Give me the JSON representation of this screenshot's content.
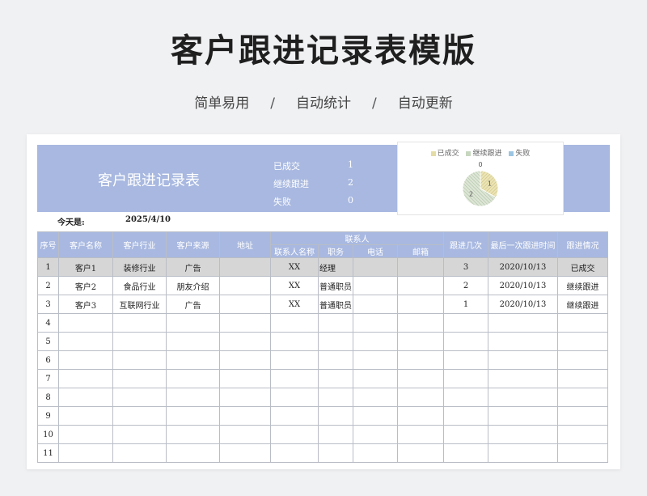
{
  "page": {
    "title": "客户跟进记录表模版",
    "features": [
      "简单易用",
      "自动统计",
      "自动更新"
    ],
    "separator": "/"
  },
  "banner": {
    "title": "客户跟进记录表",
    "stats": [
      {
        "label": "已成交",
        "value": "1"
      },
      {
        "label": "继续跟进",
        "value": "2"
      },
      {
        "label": "失败",
        "value": "0"
      }
    ]
  },
  "chart_data": {
    "type": "pie",
    "categories": [
      "已成交",
      "继续跟进",
      "失败"
    ],
    "values": [
      1,
      2,
      0
    ],
    "data_labels": [
      "1",
      "2",
      "0"
    ],
    "colors": [
      "#e4dca6",
      "#c7d6bf",
      "#9cc5e2"
    ],
    "legend": "top"
  },
  "today": {
    "label": "今天是:",
    "value": "2025/4/10"
  },
  "table": {
    "headers": {
      "seq": "序号",
      "name": "客户名称",
      "industry": "客户行业",
      "source": "客户来源",
      "address": "地址",
      "contact_group": "联系人",
      "contact_name": "联系人名称",
      "position": "职务",
      "phone": "电话",
      "email": "邮箱",
      "times": "跟进几次",
      "last_date": "最后一次跟进时间",
      "status": "跟进情况"
    },
    "rows": [
      {
        "seq": "1",
        "name": "客户1",
        "industry": "装修行业",
        "source": "广告",
        "address": "",
        "contact_name": "XX",
        "position": "经理",
        "phone": "",
        "email": "",
        "times": "3",
        "last_date": "2020/10/13",
        "status": "已成交"
      },
      {
        "seq": "2",
        "name": "客户2",
        "industry": "食品行业",
        "source": "朋友介绍",
        "address": "",
        "contact_name": "XX",
        "position": "普通职员",
        "phone": "",
        "email": "",
        "times": "2",
        "last_date": "2020/10/13",
        "status": "继续跟进"
      },
      {
        "seq": "3",
        "name": "客户3",
        "industry": "互联网行业",
        "source": "广告",
        "address": "",
        "contact_name": "XX",
        "position": "普通职员",
        "phone": "",
        "email": "",
        "times": "1",
        "last_date": "2020/10/13",
        "status": "继续跟进"
      },
      {
        "seq": "4",
        "name": "",
        "industry": "",
        "source": "",
        "address": "",
        "contact_name": "",
        "position": "",
        "phone": "",
        "email": "",
        "times": "",
        "last_date": "",
        "status": ""
      },
      {
        "seq": "5",
        "name": "",
        "industry": "",
        "source": "",
        "address": "",
        "contact_name": "",
        "position": "",
        "phone": "",
        "email": "",
        "times": "",
        "last_date": "",
        "status": ""
      },
      {
        "seq": "6",
        "name": "",
        "industry": "",
        "source": "",
        "address": "",
        "contact_name": "",
        "position": "",
        "phone": "",
        "email": "",
        "times": "",
        "last_date": "",
        "status": ""
      },
      {
        "seq": "7",
        "name": "",
        "industry": "",
        "source": "",
        "address": "",
        "contact_name": "",
        "position": "",
        "phone": "",
        "email": "",
        "times": "",
        "last_date": "",
        "status": ""
      },
      {
        "seq": "8",
        "name": "",
        "industry": "",
        "source": "",
        "address": "",
        "contact_name": "",
        "position": "",
        "phone": "",
        "email": "",
        "times": "",
        "last_date": "",
        "status": ""
      },
      {
        "seq": "9",
        "name": "",
        "industry": "",
        "source": "",
        "address": "",
        "contact_name": "",
        "position": "",
        "phone": "",
        "email": "",
        "times": "",
        "last_date": "",
        "status": ""
      },
      {
        "seq": "10",
        "name": "",
        "industry": "",
        "source": "",
        "address": "",
        "contact_name": "",
        "position": "",
        "phone": "",
        "email": "",
        "times": "",
        "last_date": "",
        "status": ""
      },
      {
        "seq": "11",
        "name": "",
        "industry": "",
        "source": "",
        "address": "",
        "contact_name": "",
        "position": "",
        "phone": "",
        "email": "",
        "times": "",
        "last_date": "",
        "status": ""
      }
    ]
  }
}
